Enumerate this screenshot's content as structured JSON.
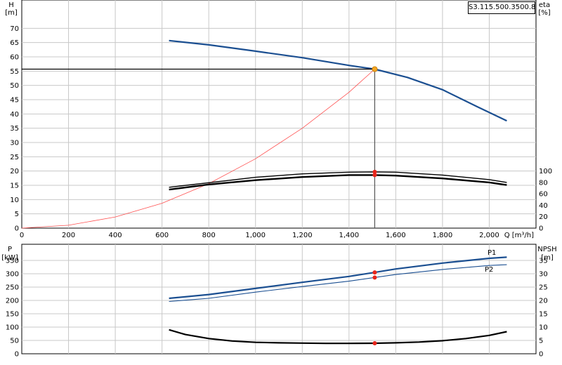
{
  "pump_id": "S3.115.500.3500.8.",
  "colors": {
    "blue": "#1b4f91",
    "black": "#000000",
    "red": "#e8251b",
    "system": "#ff5050",
    "duty_point": "#f5a623",
    "grid": "#c8c8c8"
  },
  "chart_data": [
    {
      "type": "line",
      "title": "",
      "xlabel": "Q [m³/h]",
      "x_ticks": [
        "0",
        "200",
        "400",
        "600",
        "800",
        "1,000",
        "1,200",
        "1,400",
        "1,600",
        "1,800",
        "2,000"
      ],
      "xlim": [
        0,
        2200
      ],
      "ylabel_left": "H",
      "ylabel_left_unit": "[m]",
      "ylim_left": [
        0,
        75
      ],
      "y_ticks_left": [
        "0",
        "5",
        "10",
        "15",
        "20",
        "25",
        "30",
        "35",
        "40",
        "45",
        "50",
        "55",
        "60",
        "65",
        "70"
      ],
      "ylabel_right": "eta",
      "ylabel_right_unit": "[%]",
      "ylim_right": [
        0,
        375
      ],
      "y_ticks_right": [
        "0",
        "20",
        "40",
        "60",
        "80",
        "100"
      ],
      "grid": true,
      "series": [
        {
          "key": "head",
          "axis": "left",
          "color": "#1b4f91",
          "width": 2.2,
          "x": [
            630,
            800,
            1000,
            1200,
            1400,
            1510,
            1650,
            1800,
            1950,
            2075
          ],
          "y": [
            65.7,
            64.2,
            62.0,
            59.7,
            57.0,
            55.7,
            52.8,
            48.5,
            42.5,
            37.6
          ]
        },
        {
          "key": "system",
          "axis": "left",
          "color": "#ff5050",
          "width": 0.8,
          "x": [
            0,
            200,
            400,
            600,
            800,
            1000,
            1200,
            1400,
            1510
          ],
          "y": [
            0,
            1.0,
            3.9,
            8.7,
            15.6,
            24.3,
            35.0,
            47.6,
            55.7
          ]
        },
        {
          "key": "eta_1",
          "axis": "right",
          "color": "#000000",
          "width": 1.4,
          "x": [
            630,
            800,
            1000,
            1200,
            1400,
            1510,
            1600,
            1800,
            2000,
            2075
          ],
          "y": [
            71.5,
            79.5,
            89.0,
            95.0,
            98.0,
            98.5,
            98.0,
            93.0,
            85.0,
            80.0
          ]
        },
        {
          "key": "eta_2",
          "axis": "right",
          "color": "#000000",
          "width": 2.4,
          "x": [
            630,
            800,
            1000,
            1200,
            1400,
            1510,
            1600,
            1800,
            2000,
            2075
          ],
          "y": [
            67.5,
            76.5,
            84.0,
            89.5,
            93.0,
            93.0,
            92.0,
            87.0,
            80.0,
            75.5
          ]
        }
      ],
      "duty_point": {
        "q": 1510,
        "h": 55.7,
        "eta_points": [
          98.5,
          93.0
        ]
      }
    },
    {
      "type": "line",
      "title": "",
      "xlim": [
        0,
        2200
      ],
      "ylabel_left": "P",
      "ylabel_left_unit": "[kW]",
      "ylim_left": [
        0,
        400
      ],
      "y_ticks_left": [
        "0",
        "50",
        "100",
        "150",
        "200",
        "250",
        "300",
        "350"
      ],
      "ylabel_right": "NPSH",
      "ylabel_right_unit": "[m]",
      "ylim_right": [
        0,
        40
      ],
      "y_ticks_right": [
        "0",
        "5",
        "10",
        "15",
        "20",
        "25",
        "30",
        "35"
      ],
      "grid": true,
      "series": [
        {
          "key": "p1",
          "name": "P1",
          "axis": "left",
          "color": "#1b4f91",
          "width": 2.2,
          "x": [
            630,
            800,
            1000,
            1200,
            1400,
            1510,
            1600,
            1800,
            2000,
            2075
          ],
          "y": [
            208,
            222,
            245,
            268,
            290,
            305,
            318,
            340,
            358,
            362
          ]
        },
        {
          "key": "p2",
          "name": "P2",
          "axis": "left",
          "color": "#1b4f91",
          "width": 1.1,
          "x": [
            630,
            800,
            1000,
            1200,
            1400,
            1510,
            1600,
            1800,
            2000,
            2075
          ],
          "y": [
            196,
            208,
            231,
            252,
            272,
            286,
            297,
            316,
            331,
            334
          ]
        },
        {
          "key": "npsh",
          "axis": "right",
          "color": "#000000",
          "width": 2.2,
          "x": [
            630,
            700,
            800,
            900,
            1000,
            1100,
            1200,
            1300,
            1400,
            1510,
            1600,
            1700,
            1800,
            1900,
            2000,
            2075
          ],
          "y": [
            9.0,
            7.2,
            5.7,
            4.8,
            4.3,
            4.1,
            4.0,
            3.9,
            3.9,
            3.95,
            4.1,
            4.4,
            4.9,
            5.7,
            6.9,
            8.3
          ]
        }
      ],
      "duty_point": {
        "q": 1510,
        "p_points": [
          305,
          286
        ],
        "npsh": 3.95
      }
    }
  ]
}
